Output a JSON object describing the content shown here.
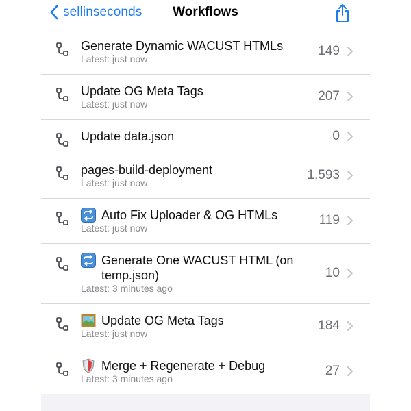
{
  "nav": {
    "back_label": "sellinseconds",
    "title": "Workflows",
    "back_icon": "chevron-left-icon",
    "share_icon": "share-icon"
  },
  "colors": {
    "accent": "#1c7cf0",
    "secondary_text": "#8a8a8e",
    "count_text": "#6e6e73",
    "separator": "#d8d8dc"
  },
  "workflows": [
    {
      "name": "Generate Dynamic WACUST HTMLs",
      "latest": "Latest: just now",
      "count": "149",
      "emoji": null
    },
    {
      "name": "Update OG Meta Tags",
      "latest": "Latest: just now",
      "count": "207",
      "emoji": null
    },
    {
      "name": "Update data.json",
      "latest": "",
      "count": "0",
      "emoji": null
    },
    {
      "name": "pages-build-deployment",
      "latest": "Latest: just now",
      "count": "1,593",
      "emoji": null
    },
    {
      "name": "Auto Fix Uploader & OG HTMLs",
      "latest": "Latest: just now",
      "count": "119",
      "emoji": "repeat-emoji"
    },
    {
      "name": "Generate One WACUST HTML (on temp.json)",
      "latest": "Latest: 3 minutes ago",
      "count": "10",
      "emoji": "repeat-emoji"
    },
    {
      "name": "Update OG Meta Tags",
      "latest": "Latest: just now",
      "count": "184",
      "emoji": "framed-picture-emoji"
    },
    {
      "name": "Merge + Regenerate + Debug",
      "latest": "Latest: 3 minutes ago",
      "count": "27",
      "emoji": "shield-emoji"
    }
  ]
}
